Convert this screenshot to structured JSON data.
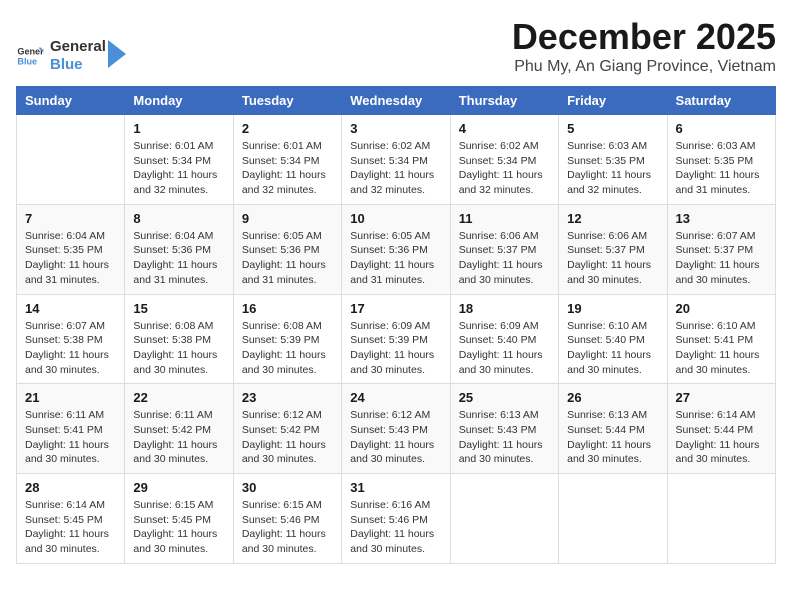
{
  "header": {
    "logo_line1": "General",
    "logo_line2": "Blue",
    "month_title": "December 2025",
    "location": "Phu My, An Giang Province, Vietnam"
  },
  "weekdays": [
    "Sunday",
    "Monday",
    "Tuesday",
    "Wednesday",
    "Thursday",
    "Friday",
    "Saturday"
  ],
  "weeks": [
    [
      {
        "day": "",
        "info": ""
      },
      {
        "day": "1",
        "info": "Sunrise: 6:01 AM\nSunset: 5:34 PM\nDaylight: 11 hours\nand 32 minutes."
      },
      {
        "day": "2",
        "info": "Sunrise: 6:01 AM\nSunset: 5:34 PM\nDaylight: 11 hours\nand 32 minutes."
      },
      {
        "day": "3",
        "info": "Sunrise: 6:02 AM\nSunset: 5:34 PM\nDaylight: 11 hours\nand 32 minutes."
      },
      {
        "day": "4",
        "info": "Sunrise: 6:02 AM\nSunset: 5:34 PM\nDaylight: 11 hours\nand 32 minutes."
      },
      {
        "day": "5",
        "info": "Sunrise: 6:03 AM\nSunset: 5:35 PM\nDaylight: 11 hours\nand 32 minutes."
      },
      {
        "day": "6",
        "info": "Sunrise: 6:03 AM\nSunset: 5:35 PM\nDaylight: 11 hours\nand 31 minutes."
      }
    ],
    [
      {
        "day": "7",
        "info": "Sunrise: 6:04 AM\nSunset: 5:35 PM\nDaylight: 11 hours\nand 31 minutes."
      },
      {
        "day": "8",
        "info": "Sunrise: 6:04 AM\nSunset: 5:36 PM\nDaylight: 11 hours\nand 31 minutes."
      },
      {
        "day": "9",
        "info": "Sunrise: 6:05 AM\nSunset: 5:36 PM\nDaylight: 11 hours\nand 31 minutes."
      },
      {
        "day": "10",
        "info": "Sunrise: 6:05 AM\nSunset: 5:36 PM\nDaylight: 11 hours\nand 31 minutes."
      },
      {
        "day": "11",
        "info": "Sunrise: 6:06 AM\nSunset: 5:37 PM\nDaylight: 11 hours\nand 30 minutes."
      },
      {
        "day": "12",
        "info": "Sunrise: 6:06 AM\nSunset: 5:37 PM\nDaylight: 11 hours\nand 30 minutes."
      },
      {
        "day": "13",
        "info": "Sunrise: 6:07 AM\nSunset: 5:37 PM\nDaylight: 11 hours\nand 30 minutes."
      }
    ],
    [
      {
        "day": "14",
        "info": "Sunrise: 6:07 AM\nSunset: 5:38 PM\nDaylight: 11 hours\nand 30 minutes."
      },
      {
        "day": "15",
        "info": "Sunrise: 6:08 AM\nSunset: 5:38 PM\nDaylight: 11 hours\nand 30 minutes."
      },
      {
        "day": "16",
        "info": "Sunrise: 6:08 AM\nSunset: 5:39 PM\nDaylight: 11 hours\nand 30 minutes."
      },
      {
        "day": "17",
        "info": "Sunrise: 6:09 AM\nSunset: 5:39 PM\nDaylight: 11 hours\nand 30 minutes."
      },
      {
        "day": "18",
        "info": "Sunrise: 6:09 AM\nSunset: 5:40 PM\nDaylight: 11 hours\nand 30 minutes."
      },
      {
        "day": "19",
        "info": "Sunrise: 6:10 AM\nSunset: 5:40 PM\nDaylight: 11 hours\nand 30 minutes."
      },
      {
        "day": "20",
        "info": "Sunrise: 6:10 AM\nSunset: 5:41 PM\nDaylight: 11 hours\nand 30 minutes."
      }
    ],
    [
      {
        "day": "21",
        "info": "Sunrise: 6:11 AM\nSunset: 5:41 PM\nDaylight: 11 hours\nand 30 minutes."
      },
      {
        "day": "22",
        "info": "Sunrise: 6:11 AM\nSunset: 5:42 PM\nDaylight: 11 hours\nand 30 minutes."
      },
      {
        "day": "23",
        "info": "Sunrise: 6:12 AM\nSunset: 5:42 PM\nDaylight: 11 hours\nand 30 minutes."
      },
      {
        "day": "24",
        "info": "Sunrise: 6:12 AM\nSunset: 5:43 PM\nDaylight: 11 hours\nand 30 minutes."
      },
      {
        "day": "25",
        "info": "Sunrise: 6:13 AM\nSunset: 5:43 PM\nDaylight: 11 hours\nand 30 minutes."
      },
      {
        "day": "26",
        "info": "Sunrise: 6:13 AM\nSunset: 5:44 PM\nDaylight: 11 hours\nand 30 minutes."
      },
      {
        "day": "27",
        "info": "Sunrise: 6:14 AM\nSunset: 5:44 PM\nDaylight: 11 hours\nand 30 minutes."
      }
    ],
    [
      {
        "day": "28",
        "info": "Sunrise: 6:14 AM\nSunset: 5:45 PM\nDaylight: 11 hours\nand 30 minutes."
      },
      {
        "day": "29",
        "info": "Sunrise: 6:15 AM\nSunset: 5:45 PM\nDaylight: 11 hours\nand 30 minutes."
      },
      {
        "day": "30",
        "info": "Sunrise: 6:15 AM\nSunset: 5:46 PM\nDaylight: 11 hours\nand 30 minutes."
      },
      {
        "day": "31",
        "info": "Sunrise: 6:16 AM\nSunset: 5:46 PM\nDaylight: 11 hours\nand 30 minutes."
      },
      {
        "day": "",
        "info": ""
      },
      {
        "day": "",
        "info": ""
      },
      {
        "day": "",
        "info": ""
      }
    ]
  ]
}
